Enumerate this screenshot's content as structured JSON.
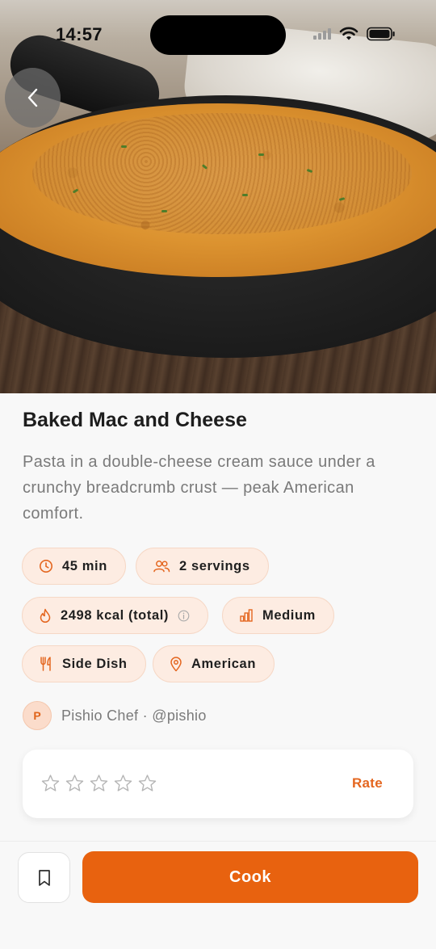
{
  "status_bar": {
    "time": "14:57"
  },
  "hero": {
    "image_subject": "baked mac and cheese in cast-iron skillet"
  },
  "recipe": {
    "title": "Baked Mac and Cheese",
    "description": "Pasta in a double-cheese cream sauce under a crunchy breadcrumb crust — peak American comfort."
  },
  "chips": {
    "time": "45 min",
    "servings": "2 servings",
    "calories": "2498 kcal (total)",
    "difficulty": "Medium",
    "category": "Side Dish",
    "cuisine": "American"
  },
  "author": {
    "initial": "P",
    "text": "Pishio Chef · @pishio"
  },
  "rating": {
    "stars_filled": 0,
    "stars_total": 5,
    "rate_label": "Rate"
  },
  "actions": {
    "cook_label": "Cook"
  },
  "colors": {
    "accent": "#e8620f",
    "chip_bg": "#fdece2",
    "chip_border": "#f6d8c6",
    "text_primary": "#1d1d1d",
    "text_secondary": "#7a7a7a"
  }
}
